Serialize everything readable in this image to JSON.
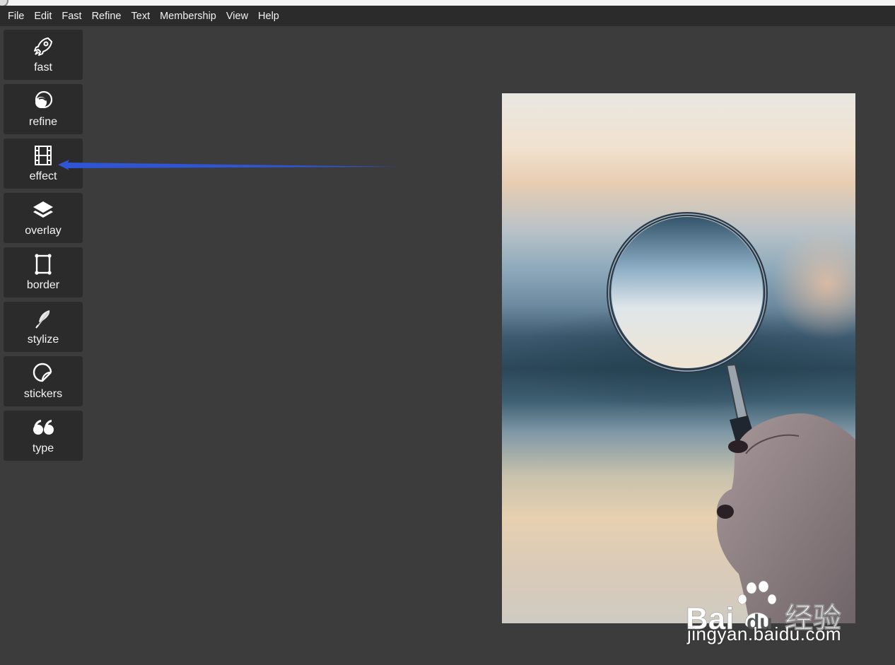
{
  "menu": [
    "File",
    "Edit",
    "Fast",
    "Refine",
    "Text",
    "Membership",
    "View",
    "Help"
  ],
  "tools": [
    {
      "label": "fast",
      "icon": "rocket-icon"
    },
    {
      "label": "refine",
      "icon": "overlap-circles-icon"
    },
    {
      "label": "effect",
      "icon": "film-icon"
    },
    {
      "label": "overlay",
      "icon": "layers-icon"
    },
    {
      "label": "border",
      "icon": "frame-icon"
    },
    {
      "label": "stylize",
      "icon": "feather-icon"
    },
    {
      "label": "stickers",
      "icon": "sticker-icon"
    },
    {
      "label": "type",
      "icon": "quote-icon"
    }
  ],
  "watermark": {
    "brand": "Bai",
    "brand_tail": "du",
    "cn": "经验",
    "url": "jingyan.baidu.com"
  },
  "colors": {
    "menubar": "#2b2b2b",
    "workspace": "#3c3c3c",
    "annotation_arrow": "#2f55d4"
  }
}
